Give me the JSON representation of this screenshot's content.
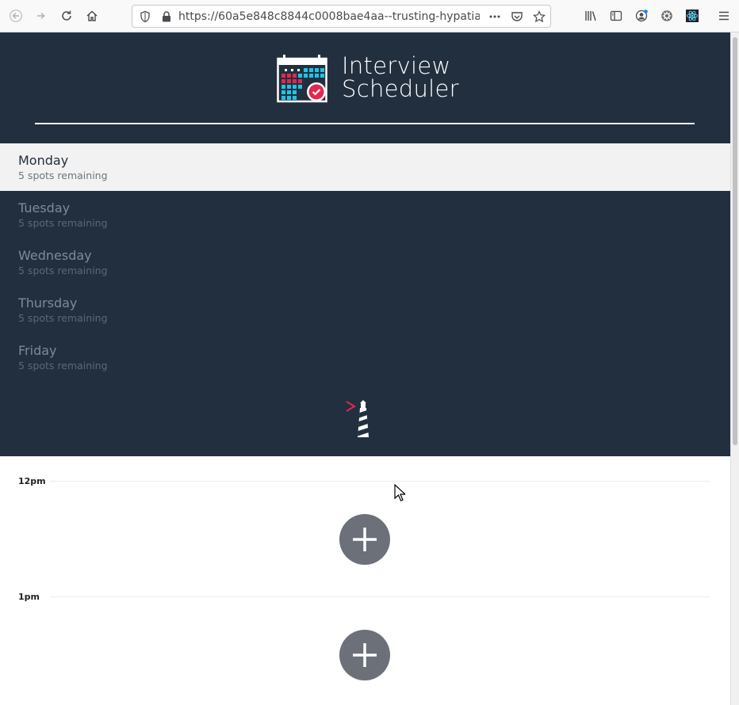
{
  "browser": {
    "url": "https://60a5e848c8844c0008bae4aa--trusting-hypatia-"
  },
  "app": {
    "title_line1": "Interview",
    "title_line2": "Scheduler",
    "colors": {
      "sidebar_bg": "#222f3e",
      "selected_bg": "#f2f2f2",
      "accent_red": "#e3284d",
      "accent_cyan": "#1ec4e6",
      "add_button_bg": "#6b7079"
    }
  },
  "days": [
    {
      "name": "Monday",
      "spots": "5 spots remaining",
      "selected": true
    },
    {
      "name": "Tuesday",
      "spots": "5 spots remaining",
      "selected": false
    },
    {
      "name": "Wednesday",
      "spots": "5 spots remaining",
      "selected": false
    },
    {
      "name": "Thursday",
      "spots": "5 spots remaining",
      "selected": false
    },
    {
      "name": "Friday",
      "spots": "5 spots remaining",
      "selected": false
    }
  ],
  "schedule": {
    "slots": [
      {
        "time": "12pm"
      },
      {
        "time": "1pm"
      }
    ]
  },
  "icons": {
    "back": "back-arrow-icon",
    "forward": "forward-arrow-icon",
    "reload": "reload-icon",
    "home": "home-icon",
    "add": "plus-icon"
  }
}
